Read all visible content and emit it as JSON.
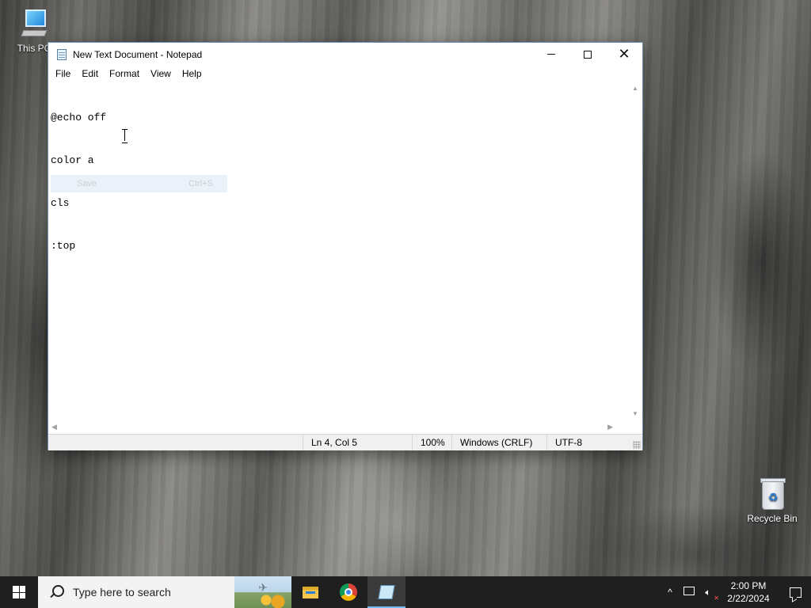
{
  "desktop": {
    "icons": [
      {
        "label": "This PC"
      },
      {
        "label": "Recycle Bin"
      }
    ]
  },
  "window": {
    "title": "New Text Document - Notepad",
    "menu": [
      "File",
      "Edit",
      "Format",
      "View",
      "Help"
    ],
    "editor_lines": [
      "@echo off",
      "color a",
      "cls",
      ":top"
    ],
    "ghost_menu": {
      "label": "Save",
      "shortcut": "Ctrl+S"
    },
    "status": {
      "position": "Ln 4, Col 5",
      "zoom": "100%",
      "line_endings": "Windows (CRLF)",
      "encoding": "UTF-8"
    }
  },
  "taskbar": {
    "search_placeholder": "Type here to search",
    "apps": [
      "file-explorer",
      "chrome",
      "notepad"
    ],
    "active_app": "notepad",
    "clock": {
      "time": "2:00 PM",
      "date": "2/22/2024"
    }
  },
  "colors": {
    "taskbar": "#1f1f1f",
    "active_indicator": "#76b9ed",
    "statusbar": "#f0f0f0"
  }
}
